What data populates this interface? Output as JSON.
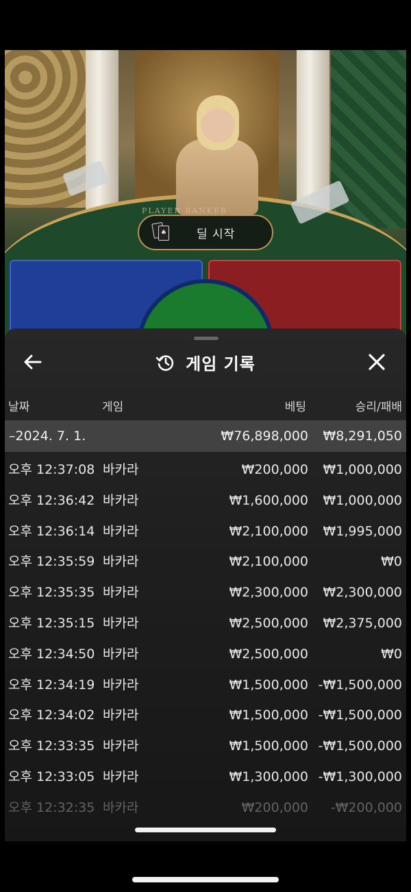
{
  "stream": {
    "table_label": "PLAYER   BANKER",
    "deal_button_label": "딜 시작",
    "deal_icon_glyph": "♠"
  },
  "sheet": {
    "title": "게임 기록",
    "icons": {
      "back": "arrow-left-icon",
      "history": "history-icon",
      "close": "close-icon"
    },
    "columns": {
      "date": "날짜",
      "game": "게임",
      "bet": "베팅",
      "win_loss": "승리/패배"
    },
    "summary": {
      "date": "–2024. 7. 1.",
      "bet": "₩76,898,000",
      "win_loss": "₩8,291,050"
    },
    "rows": [
      {
        "time": "오후 12:37:08",
        "game": "바카라",
        "bet": "₩200,000",
        "win_loss": "₩1,000,000"
      },
      {
        "time": "오후 12:36:42",
        "game": "바카라",
        "bet": "₩1,600,000",
        "win_loss": "₩1,000,000"
      },
      {
        "time": "오후 12:36:14",
        "game": "바카라",
        "bet": "₩2,100,000",
        "win_loss": "₩1,995,000"
      },
      {
        "time": "오후 12:35:59",
        "game": "바카라",
        "bet": "₩2,100,000",
        "win_loss": "₩0"
      },
      {
        "time": "오후 12:35:35",
        "game": "바카라",
        "bet": "₩2,300,000",
        "win_loss": "₩2,300,000"
      },
      {
        "time": "오후 12:35:15",
        "game": "바카라",
        "bet": "₩2,500,000",
        "win_loss": "₩2,375,000"
      },
      {
        "time": "오후 12:34:50",
        "game": "바카라",
        "bet": "₩2,500,000",
        "win_loss": "₩0"
      },
      {
        "time": "오후 12:34:19",
        "game": "바카라",
        "bet": "₩1,500,000",
        "win_loss": "-₩1,500,000"
      },
      {
        "time": "오후 12:34:02",
        "game": "바카라",
        "bet": "₩1,500,000",
        "win_loss": "-₩1,500,000"
      },
      {
        "time": "오후 12:33:35",
        "game": "바카라",
        "bet": "₩1,500,000",
        "win_loss": "-₩1,500,000"
      },
      {
        "time": "오후 12:33:05",
        "game": "바카라",
        "bet": "₩1,300,000",
        "win_loss": "-₩1,300,000"
      },
      {
        "time": "오후 12:32:35",
        "game": "바카라",
        "bet": "₩200,000",
        "win_loss": "-₩200,000"
      }
    ]
  }
}
